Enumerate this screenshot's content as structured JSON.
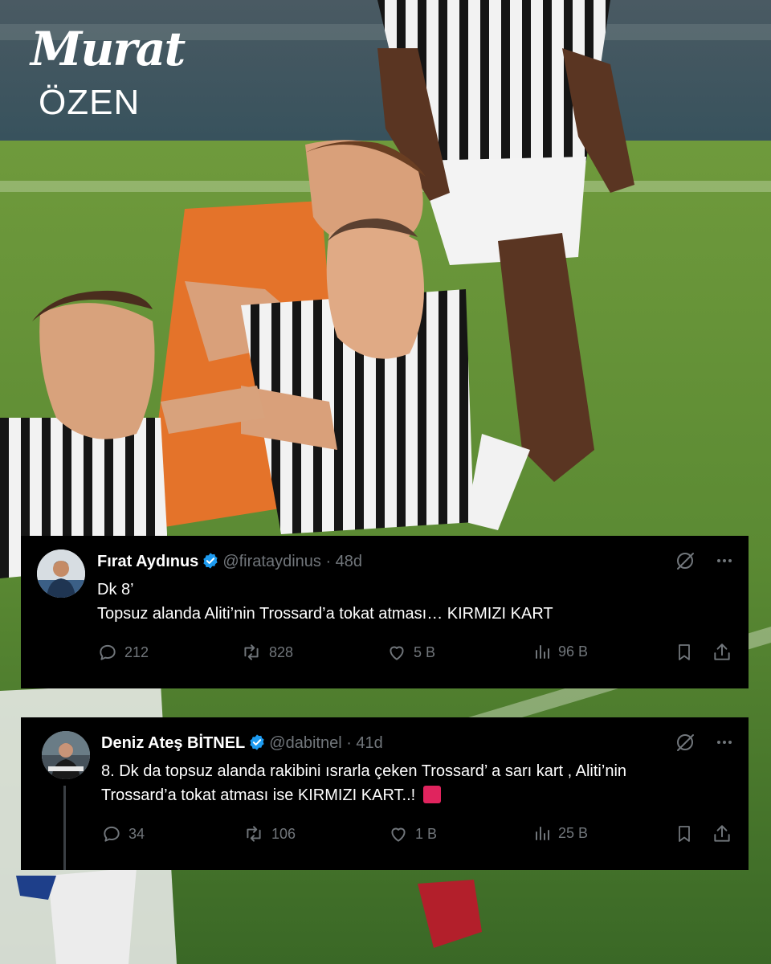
{
  "brand": {
    "script": "Murat",
    "name": "ÖZEN"
  },
  "colors": {
    "background": "#000000",
    "text": "#e7e9ea",
    "muted": "#71767b",
    "verified": "#1d9bf0",
    "red_card": "#e0245e"
  },
  "tweets": [
    {
      "name": "Fırat Aydınus",
      "handle": "@firataydinus",
      "time": "· 48d",
      "lines": [
        "Dk 8’",
        "Topsuz alanda Aliti’nin Trossard’a tokat atması… KIRMIZI KART"
      ],
      "replies": "212",
      "reposts": "828",
      "likes": "5 B",
      "views": "96 B"
    },
    {
      "name": "Deniz Ateş BİTNEL",
      "handle": "@dabitnel",
      "time": "· 41d",
      "lines": [
        "8. Dk da topsuz  alanda rakibini ısrarla çeken Trossard’ a sarı kart , Aliti’nin",
        "Trossard’a tokat atması ise KIRMIZI KART..!"
      ],
      "emoji": "red-square",
      "replies": "34",
      "reposts": "106",
      "likes": "1 B",
      "views": "25 B"
    }
  ]
}
